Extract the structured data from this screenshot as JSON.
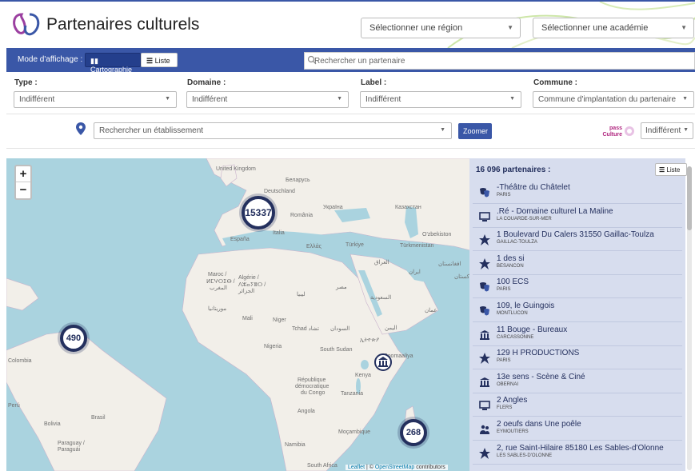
{
  "header": {
    "title": "Partenaires culturels",
    "region_placeholder": "Sélectionner une région",
    "academie_placeholder": "Sélectionner une académie"
  },
  "modebar": {
    "label": "Mode d'affichage :",
    "carto_label": "Cartographie",
    "liste_label": "Liste",
    "search_placeholder": "Rechercher un partenaire"
  },
  "filters": [
    {
      "label": "Type :",
      "value": "Indifférent"
    },
    {
      "label": "Domaine :",
      "value": "Indifférent"
    },
    {
      "label": "Label :",
      "value": "Indifférent"
    },
    {
      "label": "Commune :",
      "value": "Commune d'implantation du partenaire"
    }
  ],
  "etablissement": {
    "placeholder": "Rechercher un établissement",
    "zoom_label": "Zoomer",
    "pass_logo_text_1": "pass",
    "pass_logo_text_2": "Culture",
    "pass_value": "Indifférent"
  },
  "map": {
    "zoom_in": "+",
    "zoom_out": "−",
    "clusters": [
      "15337",
      "490",
      "268"
    ],
    "attribution_leaflet": "Leaflet",
    "attribution_sep": " | © ",
    "attribution_osm": "OpenStreetMap",
    "attribution_tail": " contributors",
    "labels": {
      "uk": "United Kingdom",
      "belarus": "Беларусь",
      "deutschland": "Deutschland",
      "ukraina": "Україна",
      "kazakhstan": "Казахстан",
      "romania": "România",
      "italia": "Italia",
      "uzbekistan": "O'zbekiston",
      "espana": "España",
      "ellada": "Ελλάς",
      "turkiye": "Türkiye",
      "turkmenistan": "Türkmenistan",
      "iraq": "العراق",
      "iran": "ایران",
      "afghanistan": "افغانستان",
      "pakistan": "پاکستان",
      "maroc": "Maroc /",
      "maroc2": "ⵍⵎⵖⵔⵉⴱ /",
      "maroc3": "المغرب",
      "algerie": "Algérie /",
      "algerie2": "ⴷⵣⴰⵢⴻⵔ /",
      "algerie3": "الجزائر",
      "libya": "ليبيا",
      "egypt": "مصر",
      "saudi": "السعودية",
      "oman": "عمان",
      "mauritania": "موريتانيا",
      "mali": "Mali",
      "niger": "Niger",
      "tchad": "Tchad تشاد",
      "sudan": "السودان",
      "yemen": "اليمن",
      "nigeria": "Nigeria",
      "south_sudan": "South Sudan",
      "ethiopia": "ኢትዮጵያ",
      "somalia": "Soomaaliya",
      "kenya": "Kenya",
      "rdc": "République",
      "rdc2": "démocratique",
      "rdc3": "du Congo",
      "tanzania": "Tanzania",
      "angola": "Angola",
      "mocambique": "Moçambique",
      "namibia": "Namibia",
      "south_africa": "South Africa",
      "colombia": "Colombia",
      "peru": "Perú",
      "brasil": "Brasil",
      "bolivia": "Bolivia",
      "paraguay": "Paraguay /",
      "paraguay2": "Paraguái"
    }
  },
  "panel": {
    "count_label": "16 096 partenaires :",
    "liste_label": "Liste",
    "items": [
      {
        "name": "-Théâtre du Châtelet",
        "city": "PARIS",
        "icon": "theater-masks-icon"
      },
      {
        "name": ".Ré - Domaine culturel La Maline",
        "city": "LA COUARDE-SUR-MER",
        "icon": "cinema-screen-icon"
      },
      {
        "name": "1 Boulevard Du Calers 31550 Gaillac-Toulza",
        "city": "GAILLAC-TOULZA",
        "icon": "star-burst-icon"
      },
      {
        "name": "1 des si",
        "city": "BESANCON",
        "icon": "star-burst-icon"
      },
      {
        "name": "100 ECS",
        "city": "PARIS",
        "icon": "theater-masks-icon"
      },
      {
        "name": "109, le Guingois",
        "city": "MONTLUCON",
        "icon": "theater-masks-icon"
      },
      {
        "name": "11 Bouge - Bureaux",
        "city": "CARCASSONNE",
        "icon": "museum-icon"
      },
      {
        "name": "129 H PRODUCTIONS",
        "city": "PARIS",
        "icon": "star-burst-icon"
      },
      {
        "name": "13e sens - Scène & Ciné",
        "city": "OBERNAI",
        "icon": "museum-icon"
      },
      {
        "name": "2 Angles",
        "city": "FLERS",
        "icon": "cinema-screen-icon"
      },
      {
        "name": "2 oeufs dans Une poêle",
        "city": "EYMOUTIERS",
        "icon": "people-icon"
      },
      {
        "name": "2, rue Saint-Hilaire 85180 Les Sables-d'Olonne",
        "city": "LES SABLES-D'OLONNE",
        "icon": "star-burst-icon"
      }
    ]
  }
}
